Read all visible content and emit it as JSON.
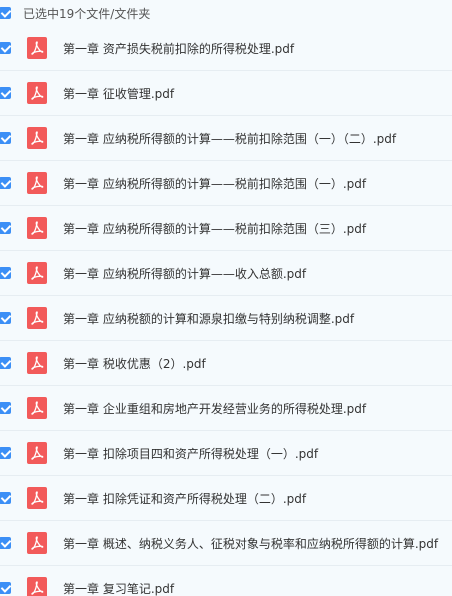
{
  "header": {
    "label": "已选中19个文件/文件夹"
  },
  "files": [
    {
      "name": "第一章 资产损失税前扣除的所得税处理.pdf"
    },
    {
      "name": "第一章 征收管理.pdf"
    },
    {
      "name": "第一章 应纳税所得额的计算——税前扣除范围（一）（二）.pdf"
    },
    {
      "name": "第一章 应纳税所得额的计算——税前扣除范围（一）.pdf"
    },
    {
      "name": "第一章 应纳税所得额的计算——税前扣除范围（三）.pdf"
    },
    {
      "name": "第一章 应纳税所得额的计算——收入总额.pdf"
    },
    {
      "name": "第一章 应纳税额的计算和源泉扣缴与特别纳税调整.pdf"
    },
    {
      "name": "第一章 税收优惠（2）.pdf"
    },
    {
      "name": "第一章 企业重组和房地产开发经营业务的所得税处理.pdf"
    },
    {
      "name": "第一章 扣除项目四和资产所得税处理（一）.pdf"
    },
    {
      "name": "第一章 扣除凭证和资产所得税处理（二）.pdf"
    },
    {
      "name": "第一章 概述、纳税义务人、征税对象与税率和应纳税所得额的计算.pdf"
    },
    {
      "name": "第一章 复习笔记.pdf"
    }
  ],
  "colors": {
    "accent": "#3c8ff6",
    "pdf": "#f25a5a"
  }
}
